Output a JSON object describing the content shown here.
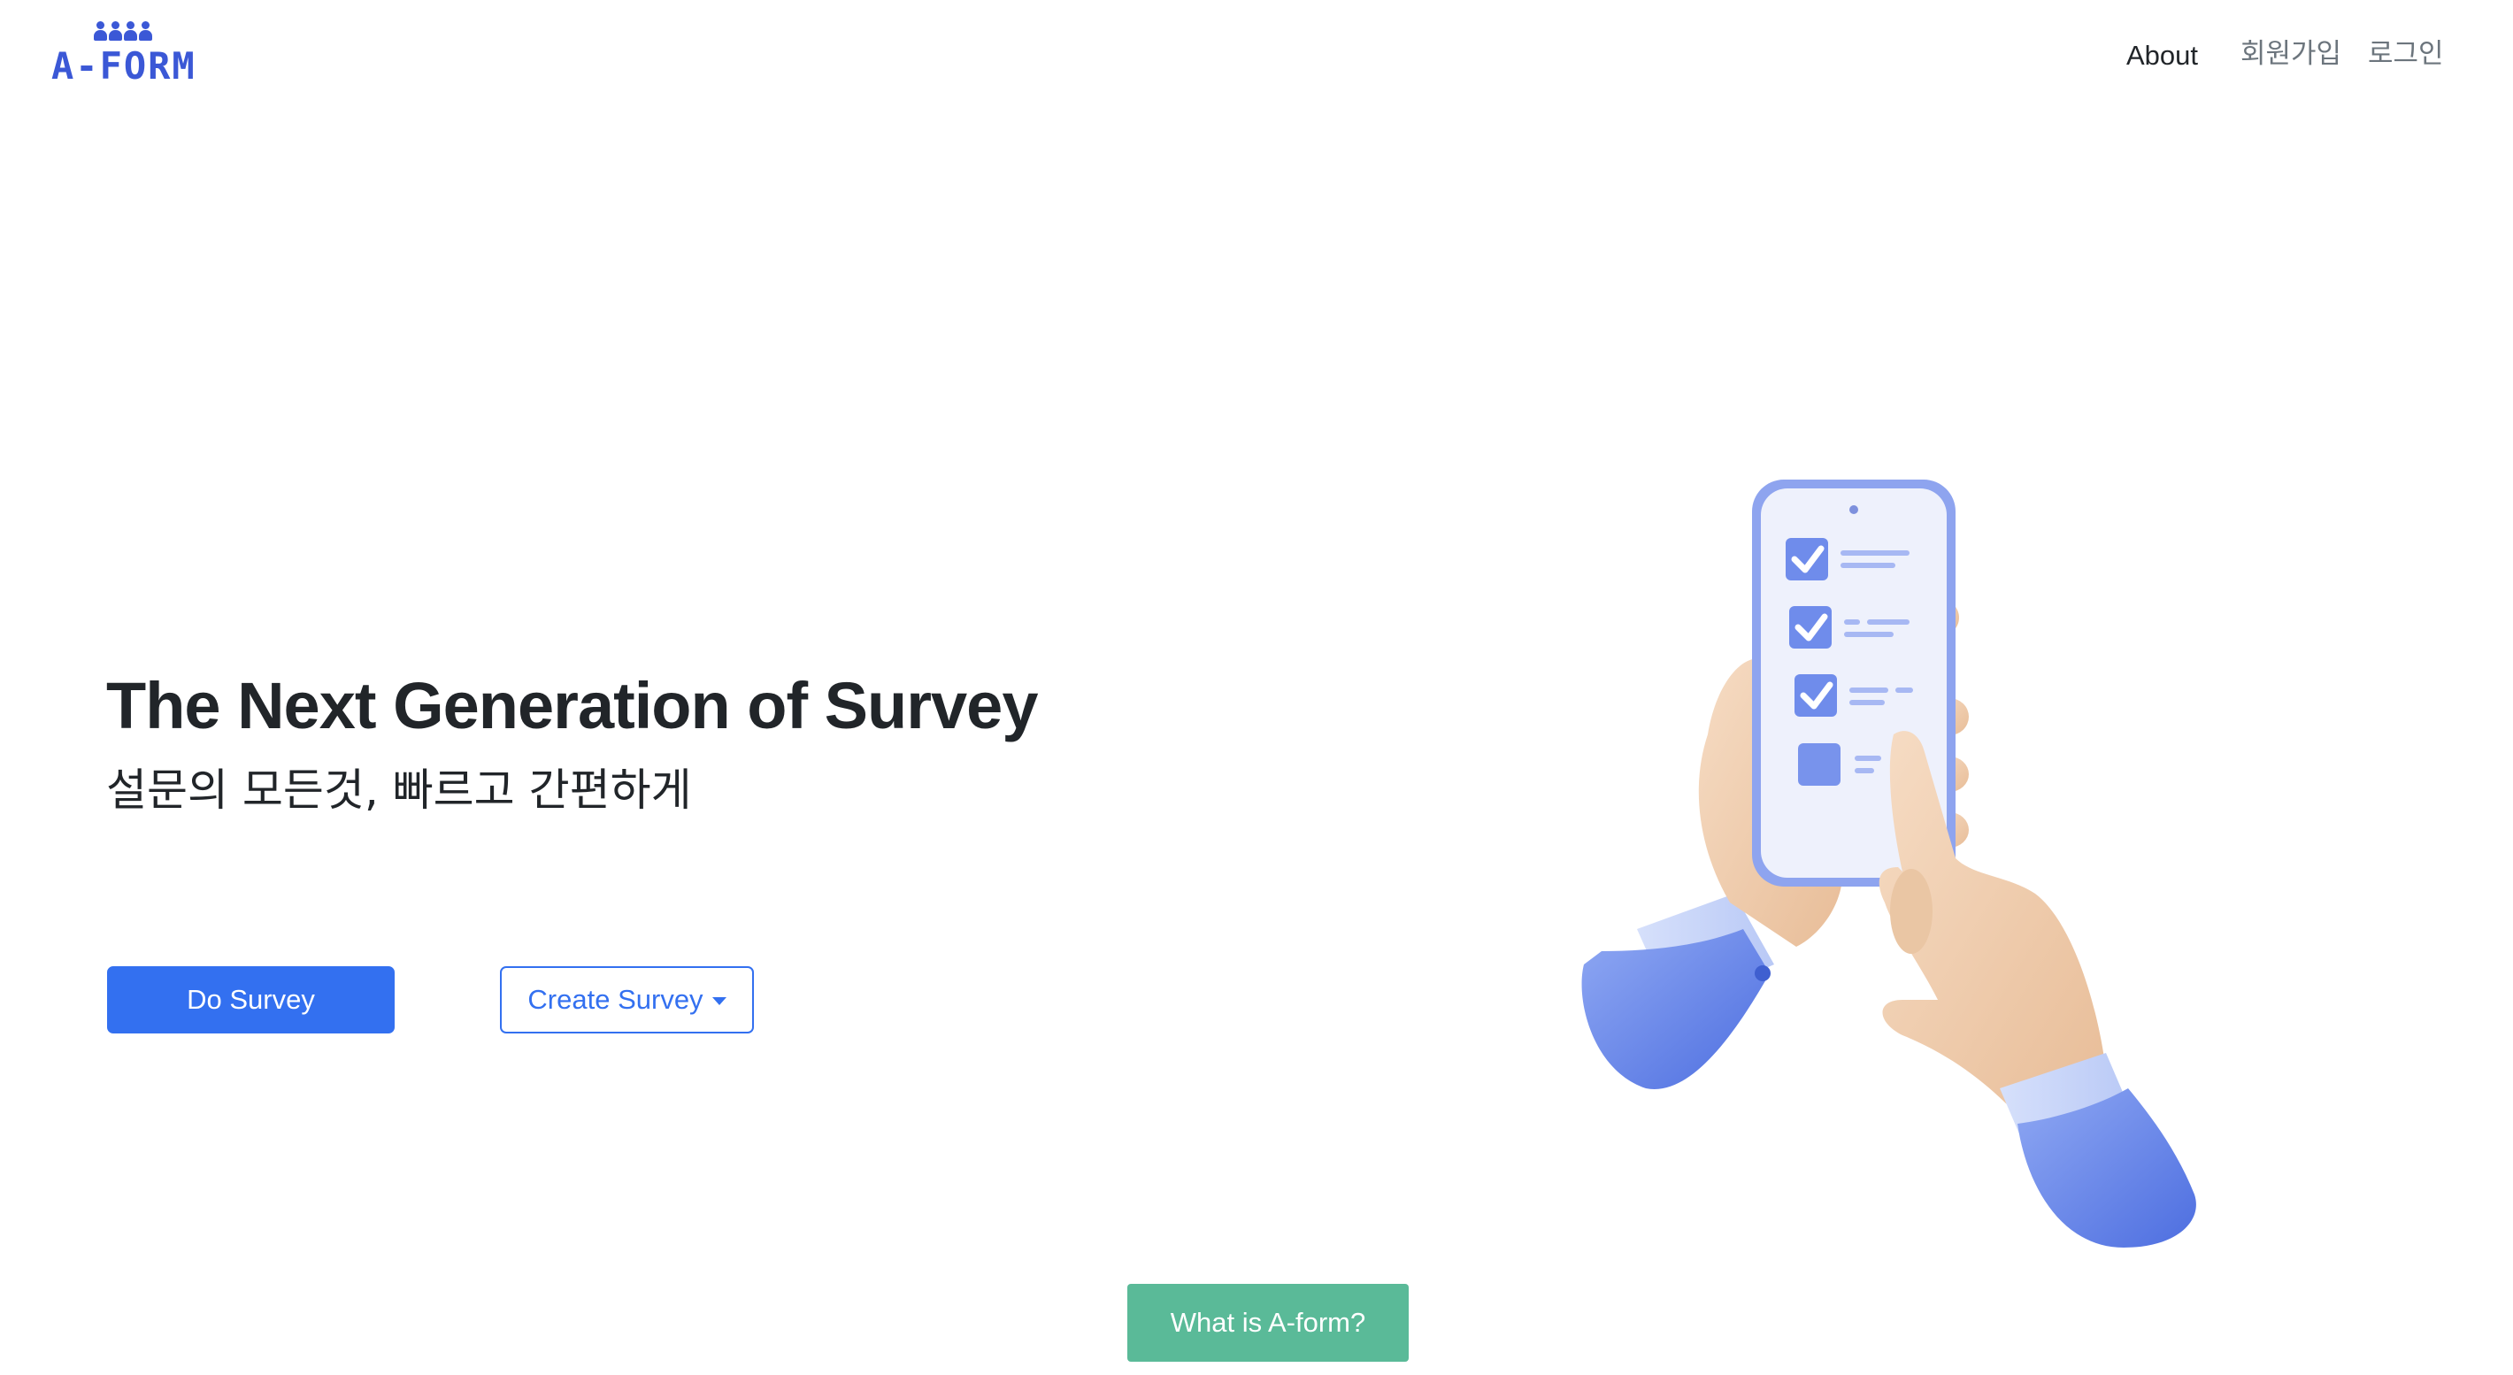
{
  "header": {
    "logo_text": "A-FORM",
    "nav": {
      "about": "About",
      "signup": "회원가입",
      "login": "로그인"
    }
  },
  "hero": {
    "title": "The Next Generation of Survey",
    "subtitle": "설문의 모든것, 빠르고 간편하게"
  },
  "buttons": {
    "do_survey": "Do Survey",
    "create_survey": "Create Survey",
    "what_is": "What is A-form?"
  },
  "colors": {
    "brand": "#3b58d6",
    "primary": "#3370f0",
    "success": "#5aba98",
    "text_dark": "#212529",
    "nav_muted": "#6c757d"
  },
  "icons": {
    "logo_people": "people-group-icon",
    "create_caret": "caret-down-icon",
    "hero_illustration": "phone-checklist-hands-illustration"
  }
}
